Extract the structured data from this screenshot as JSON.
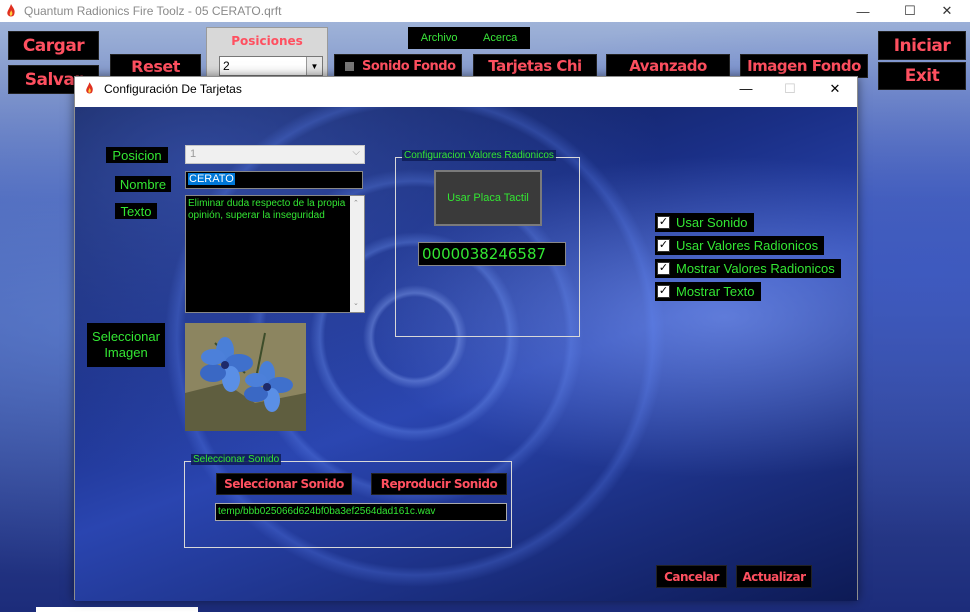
{
  "main_window": {
    "title": "Quantum Radionics Fire Toolz - 05 CERATO.qrft",
    "controls": {
      "minimize": "—",
      "maximize": "☐",
      "close": "✕"
    },
    "buttons": {
      "cargar": "Cargar",
      "salvar": "Salvar",
      "reset": "Reset",
      "sonido_fondo": "Sonido Fondo",
      "tarjetas_chi": "Tarjetas Chi",
      "avanzado": "Avanzado",
      "imagen_fondo": "Imagen Fondo",
      "iniciar": "Iniciar",
      "exit": "Exit"
    },
    "menu": {
      "archivo": "Archivo",
      "acerca": "Acerca"
    },
    "posiciones": {
      "label": "Posiciones",
      "value": "2"
    }
  },
  "dialog": {
    "title": "Configuración De Tarjetas",
    "controls": {
      "minimize": "—",
      "maximize": "☐",
      "close": "✕"
    },
    "labels": {
      "posicion": "Posicion",
      "nombre": "Nombre",
      "texto": "Texto",
      "seleccionar_imagen": "Seleccionar Imagen"
    },
    "posicion_value": "1",
    "nombre_value": "CERATO",
    "texto_value": "Eliminar duda respecto de la propia opinión, superar la inseguridad",
    "radionic_group": {
      "legend": "Configuracion Valores Radionicos",
      "tactil_button": "Usar Placa Tactil",
      "value": "0000038246587"
    },
    "checkboxes": [
      {
        "label": "Usar Sonido",
        "checked": true
      },
      {
        "label": "Usar Valores Radionicos",
        "checked": true
      },
      {
        "label": "Mostrar Valores Radionicos",
        "checked": true
      },
      {
        "label": "Mostrar Texto",
        "checked": true
      }
    ],
    "sound_group": {
      "legend": "Seleccionar Sonido",
      "select_button": "Seleccionar Sonido",
      "play_button": "Reproducir Sonido",
      "file": "temp/bbb025066d624bf0ba3ef2564dad161c.wav"
    },
    "footer": {
      "cancel": "Cancelar",
      "update": "Actualizar"
    }
  },
  "colors": {
    "accent_green": "#33e633",
    "accent_red": "#ff5060",
    "control_black": "#000000"
  }
}
